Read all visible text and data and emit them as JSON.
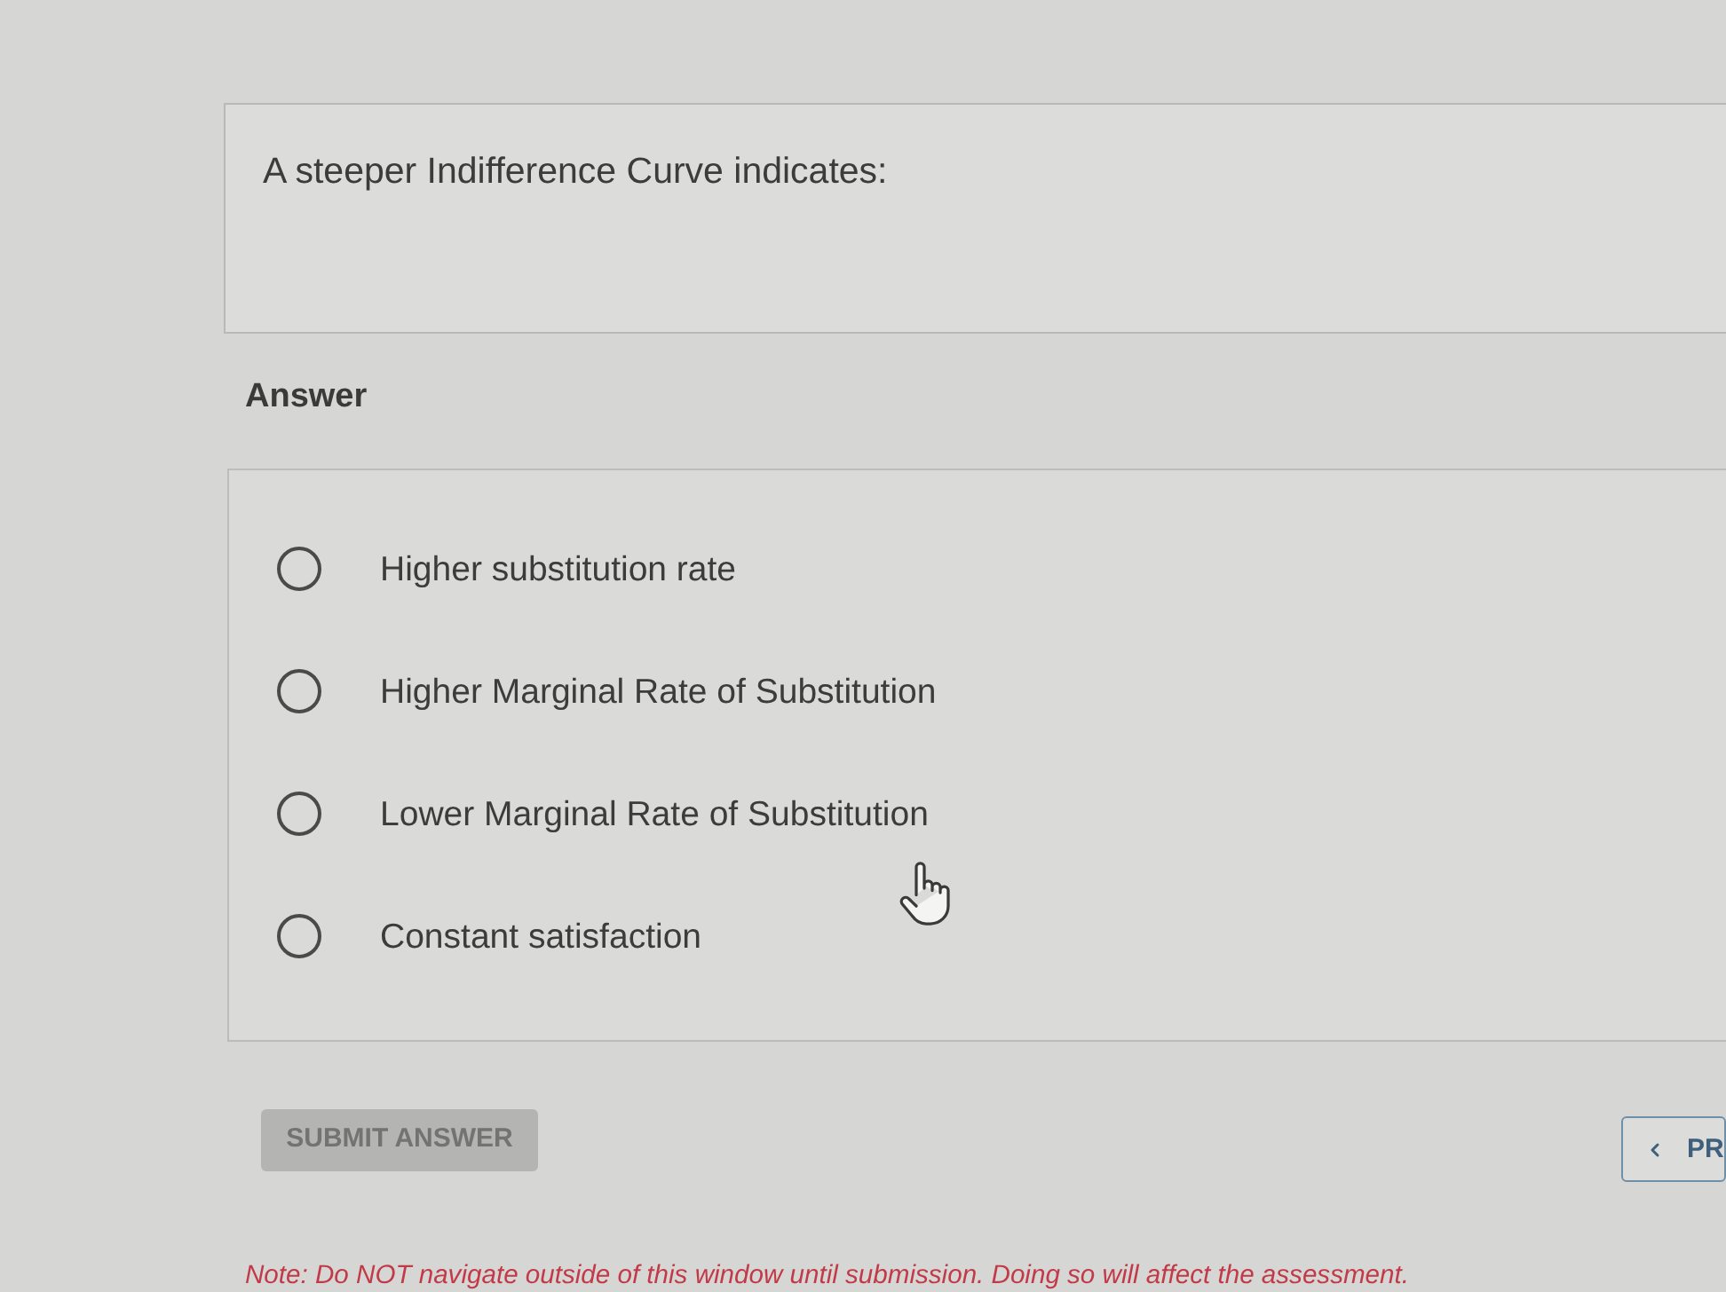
{
  "question": {
    "text": "A steeper Indifference Curve indicates:"
  },
  "answer_label": "Answer",
  "options": [
    {
      "label": "Higher substitution rate",
      "selected": false
    },
    {
      "label": "Higher Marginal Rate of Substitution",
      "selected": false
    },
    {
      "label": "Lower Marginal Rate of Substitution",
      "selected": false
    },
    {
      "label": "Constant satisfaction",
      "selected": false
    }
  ],
  "submit_button": {
    "label": "SUBMIT ANSWER",
    "disabled": true
  },
  "prev_button": {
    "label": "PR"
  },
  "note": "Note: Do NOT navigate outside of this window until submission. Doing so will affect the assessment."
}
